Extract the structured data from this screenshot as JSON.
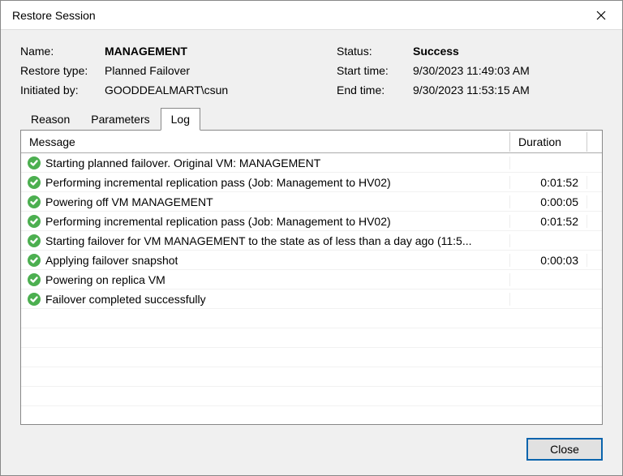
{
  "dialog": {
    "title": "Restore Session"
  },
  "info": {
    "name_label": "Name:",
    "name_value": "MANAGEMENT",
    "restore_type_label": "Restore type:",
    "restore_type_value": "Planned Failover",
    "initiated_by_label": "Initiated by:",
    "initiated_by_value": "GOODDEALMART\\csun",
    "status_label": "Status:",
    "status_value": "Success",
    "start_time_label": "Start time:",
    "start_time_value": "9/30/2023 11:49:03 AM",
    "end_time_label": "End time:",
    "end_time_value": "9/30/2023 11:53:15 AM"
  },
  "tabs": {
    "reason": "Reason",
    "parameters": "Parameters",
    "log": "Log"
  },
  "log": {
    "col_message": "Message",
    "col_duration": "Duration",
    "rows": [
      {
        "message": "Starting planned failover. Original VM: MANAGEMENT",
        "duration": ""
      },
      {
        "message": "Performing incremental replication pass (Job: Management to HV02)",
        "duration": "0:01:52"
      },
      {
        "message": "Powering off VM MANAGEMENT",
        "duration": "0:00:05"
      },
      {
        "message": "Performing incremental replication pass (Job: Management to HV02)",
        "duration": "0:01:52"
      },
      {
        "message": "Starting failover for VM MANAGEMENT to the state as of less than a day ago (11:5...",
        "duration": ""
      },
      {
        "message": "Applying failover snapshot",
        "duration": "0:00:03"
      },
      {
        "message": "Powering on replica VM",
        "duration": ""
      },
      {
        "message": "Failover completed successfully",
        "duration": ""
      }
    ]
  },
  "footer": {
    "close_label": "Close"
  }
}
